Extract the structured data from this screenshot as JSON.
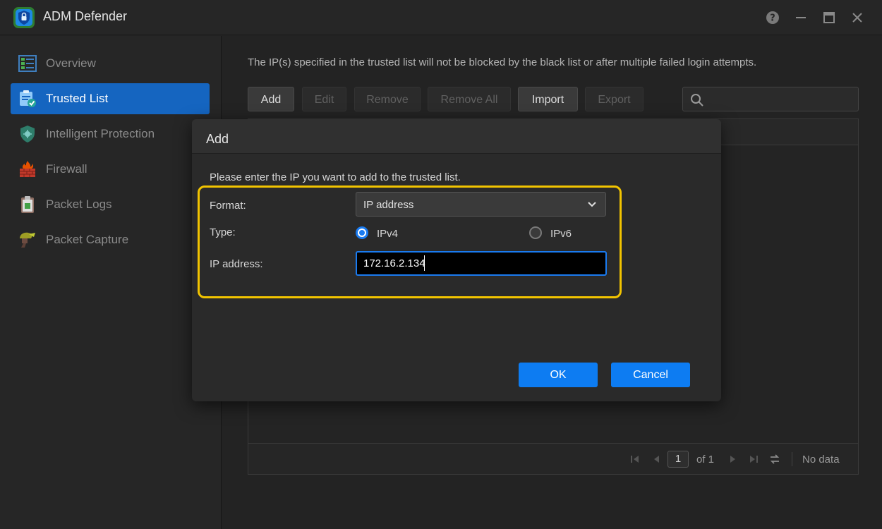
{
  "app": {
    "title": "ADM Defender"
  },
  "sidebar": {
    "items": [
      {
        "label": "Overview",
        "icon": "overview-icon",
        "active": false
      },
      {
        "label": "Trusted List",
        "icon": "trusted-list-icon",
        "active": true
      },
      {
        "label": "Intelligent Protection",
        "icon": "shield-icon",
        "active": false
      },
      {
        "label": "Firewall",
        "icon": "firewall-icon",
        "active": false
      },
      {
        "label": "Packet Logs",
        "icon": "clipboard-icon",
        "active": false
      },
      {
        "label": "Packet Capture",
        "icon": "capture-icon",
        "active": false
      }
    ]
  },
  "main": {
    "description": "The IP(s) specified in the trusted list will not be blocked by the black list or after multiple failed login attempts.",
    "toolbar": {
      "add": "Add",
      "edit": "Edit",
      "remove": "Remove",
      "remove_all": "Remove All",
      "import": "Import",
      "export": "Export"
    },
    "search": {
      "placeholder": ""
    },
    "pagination": {
      "page": "1",
      "of_label": "of 1",
      "status": "No data"
    }
  },
  "dialog": {
    "title": "Add",
    "instruction": "Please enter the IP you want to add to the trusted list.",
    "format_label": "Format:",
    "format_value": "IP address",
    "type_label": "Type:",
    "ipv4_label": "IPv4",
    "ipv6_label": "IPv6",
    "selected_type": "IPv4",
    "ip_label": "IP address:",
    "ip_value": "172.16.2.134",
    "ok_label": "OK",
    "cancel_label": "Cancel"
  },
  "colors": {
    "accent": "#1a7bf0",
    "highlight": "#f2c400",
    "sidebar_active": "#1565c0"
  }
}
